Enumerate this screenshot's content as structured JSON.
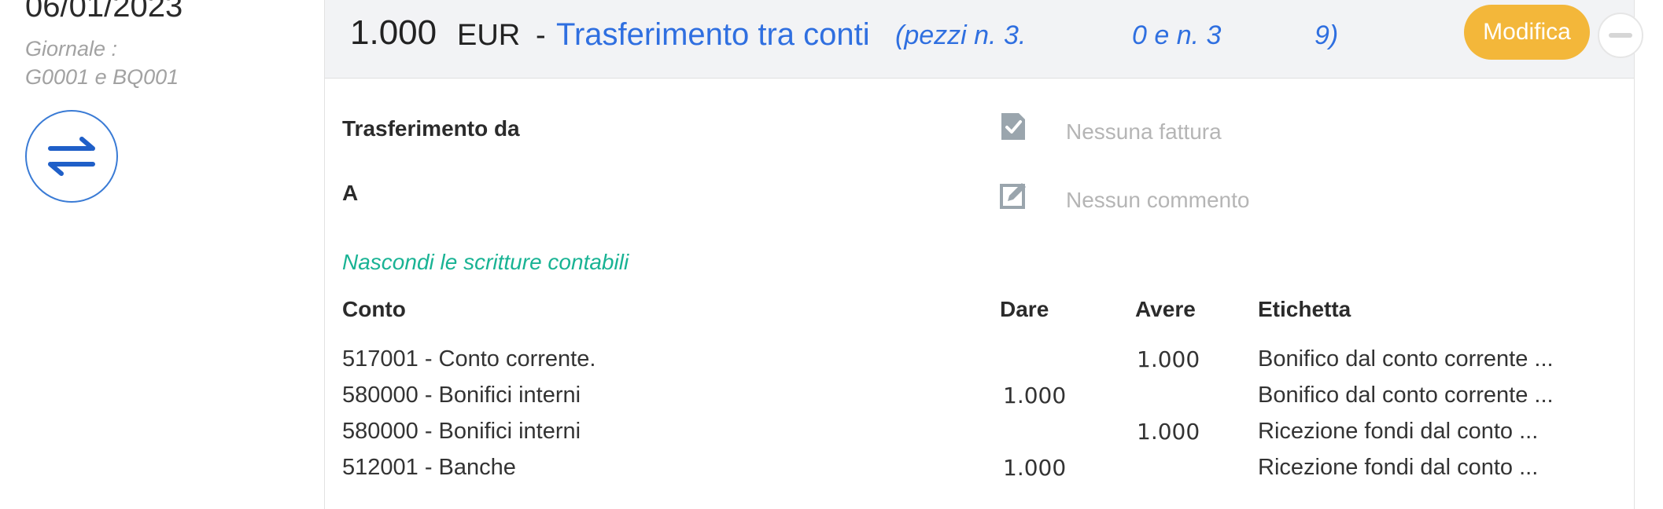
{
  "left": {
    "date": "06/01/2023",
    "journal_line1": "Giornale :",
    "journal_line2": "G0001 e BQ001",
    "icon": "transfer-arrows-icon"
  },
  "header": {
    "amount": "1.000",
    "currency": "EUR",
    "separator": "-",
    "title": "Trasferimento tra conti",
    "pieces_part1": "(pezzi n. 3.",
    "pieces_part2": "0 e n. 3",
    "pieces_part3": "9)",
    "edit_label": "Modifica",
    "collapse_icon": "minus-icon"
  },
  "details": {
    "from_label": "Trasferimento da",
    "to_label": "A",
    "invoice_text": "Nessuna fattura",
    "comment_text": "Nessun commento",
    "toggle_entries": "Nascondi le scritture contabili"
  },
  "table": {
    "headers": {
      "account": "Conto",
      "debit": "Dare",
      "credit": "Avere",
      "label": "Etichetta"
    },
    "rows": [
      {
        "account": "517001 - Conto corrente.",
        "debit": "",
        "credit": "1.000",
        "label": "Bonifico dal conto corrente ..."
      },
      {
        "account": "580000 - Bonifici interni",
        "debit": "1.000",
        "credit": "",
        "label": "Bonifico dal conto corrente ..."
      },
      {
        "account": "580000 - Bonifici interni",
        "debit": "",
        "credit": "1.000",
        "label": "Ricezione fondi dal conto ..."
      },
      {
        "account": "512001 - Banche",
        "debit": "1.000",
        "credit": "",
        "label": "Ricezione fondi dal conto ..."
      }
    ]
  },
  "colors": {
    "accent_blue": "#2f6fe0",
    "edit_button": "#f3b73a",
    "toggle_green": "#19b394",
    "header_bg": "#f2f3f5"
  }
}
